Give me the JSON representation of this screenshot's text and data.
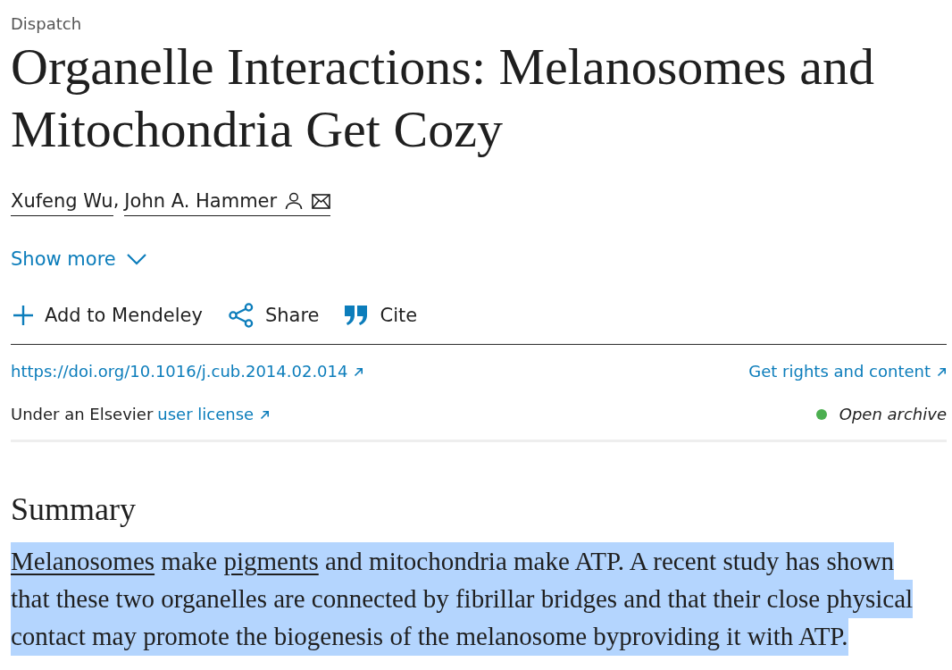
{
  "article_type": "Dispatch",
  "title": "Organelle Interactions: Melanosomes and Mitochondria Get Cozy",
  "authors": [
    {
      "name": "Xufeng Wu",
      "corresponding": false
    },
    {
      "name": "John A. Hammer",
      "corresponding": true
    }
  ],
  "author_separator": ",",
  "show_more": {
    "label": "Show more",
    "expanded": false
  },
  "actions": [
    {
      "kind": "add",
      "label": "Add to Mendeley"
    },
    {
      "kind": "share",
      "label": "Share"
    },
    {
      "kind": "cite",
      "label": "Cite"
    }
  ],
  "doi_link": "https://doi.org/10.1016/j.cub.2014.02.014",
  "rights_link": "Get rights and content",
  "license": {
    "text": "Under an Elsevier",
    "link": "user license"
  },
  "access": {
    "label": "Open archive"
  },
  "summary": {
    "heading": "Summary",
    "selected": true,
    "parts": [
      {
        "kind": "link",
        "text": "Melanosomes"
      },
      {
        "kind": "text",
        "text": " make "
      },
      {
        "kind": "link",
        "text": "pigments"
      },
      {
        "kind": "text",
        "text": " and mitochondria make ATP. A recent study has shown that these two organelles are connected by fibrillar bridges and that their close physical contact may promote the biogenesis of the melanosome byproviding it with ATP."
      }
    ]
  }
}
